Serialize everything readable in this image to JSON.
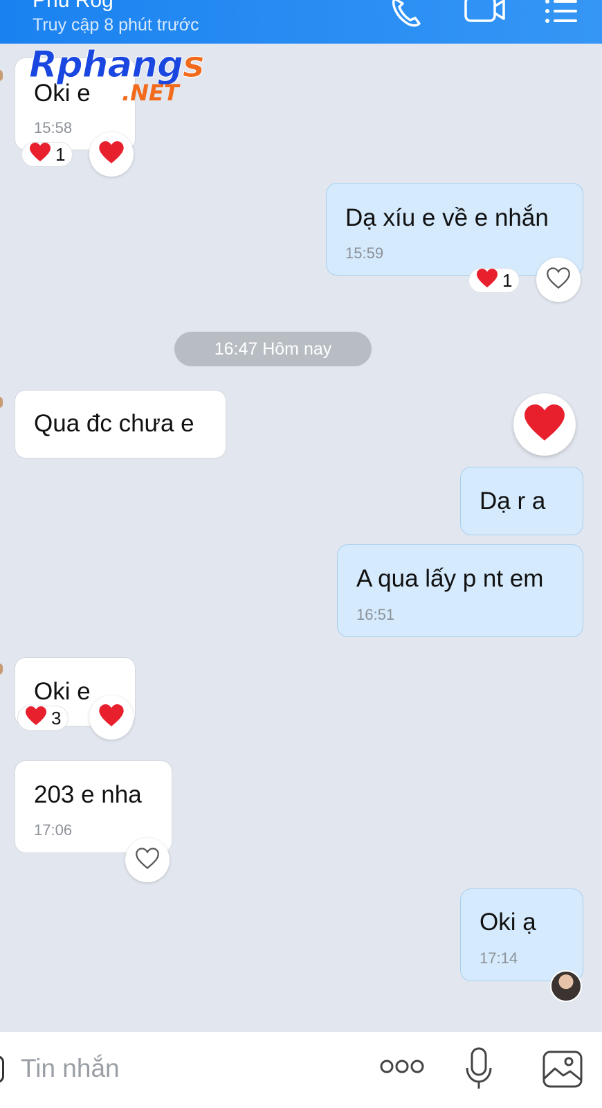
{
  "header": {
    "contact_name": "Phú Rog",
    "status": "Truy cập 8 phút trước",
    "icons": [
      "phone-icon",
      "video-call-icon",
      "menu-list-icon"
    ]
  },
  "watermark": {
    "brand": "Rphangs",
    "suffix": ".NET"
  },
  "messages": [
    {
      "direction": "incoming",
      "text": "Oki e",
      "time": "15:58",
      "reaction_count": "1"
    },
    {
      "direction": "outgoing",
      "text": "Dạ xíu e về e nhắn",
      "time": "15:59",
      "reaction_count": "1"
    },
    {
      "direction": "incoming",
      "text": "Qua đc chưa e"
    },
    {
      "direction": "outgoing",
      "text": "Dạ r a"
    },
    {
      "direction": "outgoing",
      "text": "A qua lấy p nt em",
      "time": "16:51"
    },
    {
      "direction": "incoming",
      "text": "Oki e",
      "reaction_count": "3"
    },
    {
      "direction": "incoming",
      "text": "203 e nha",
      "time": "17:06"
    },
    {
      "direction": "outgoing",
      "text": "Oki ạ",
      "time": "17:14"
    }
  ],
  "date_separator": "16:47 Hôm nay",
  "composer": {
    "placeholder": "Tin nhắn",
    "icons": [
      "more-options-icon",
      "microphone-icon",
      "image-icon"
    ]
  },
  "colors": {
    "header_start": "#1a82f0",
    "header_end": "#3596f5",
    "chat_background": "#e2e7ef",
    "incoming_bubble": "#ffffff",
    "outgoing_bubble": "#d5eafc",
    "heart": "#e8202e"
  }
}
